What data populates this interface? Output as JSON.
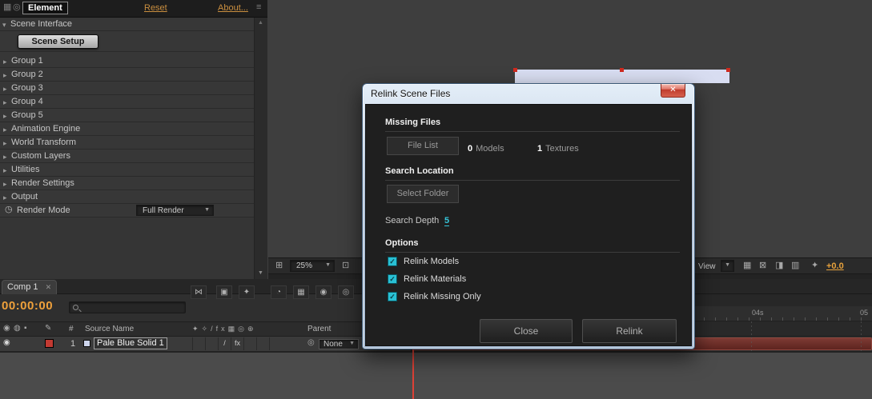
{
  "effect_panel": {
    "effect_name": "Element",
    "reset_label": "Reset",
    "about_label": "About...",
    "scene_interface_label": "Scene Interface",
    "scene_setup_button": "Scene Setup",
    "groups": [
      "Group 1",
      "Group 2",
      "Group 3",
      "Group 4",
      "Group 5",
      "Animation Engine",
      "World Transform",
      "Custom Layers",
      "Utilities",
      "Render Settings",
      "Output"
    ],
    "render_mode_label": "Render Mode",
    "render_mode_value": "Full Render"
  },
  "viewport": {
    "zoom_value": "25%",
    "view_label": "View",
    "exposure_value": "+0.0"
  },
  "dialog": {
    "title": "Relink Scene Files",
    "missing_files_heading": "Missing Files",
    "file_list_button": "File List",
    "models_count": "0",
    "models_label": "Models",
    "textures_count": "1",
    "textures_label": "Textures",
    "search_location_heading": "Search Location",
    "select_folder_button": "Select Folder",
    "search_depth_label": "Search Depth",
    "search_depth_value": "5",
    "options_heading": "Options",
    "checkboxes": [
      {
        "label": "Relink Models",
        "checked": true
      },
      {
        "label": "Relink Materials",
        "checked": true
      },
      {
        "label": "Relink Missing Only",
        "checked": true
      }
    ],
    "close_button": "Close",
    "relink_button": "Relink",
    "accent_color": "#29c0d4"
  },
  "timeline": {
    "tab_label": "Comp 1",
    "timecode": "00:00:00",
    "search_value": "",
    "columns": {
      "number": "#",
      "source": "Source Name",
      "parent": "Parent"
    },
    "switch_header_glyphs": "✦✧/fx▦◎⊕",
    "layer": {
      "index": "1",
      "name": "Pale Blue Solid 1",
      "quality_glyph": "/",
      "fx_glyph": "fx",
      "parent_value": "None"
    },
    "ruler_labels": [
      "04s",
      "05"
    ]
  },
  "icons": {
    "panel_grid_icon": "▦",
    "effect_badge_icon": "◎",
    "panel_menu_icon": "≡",
    "expand_open_icon": "▾",
    "expand_closed_icon": "▸",
    "stopwatch_icon": "◷",
    "dropdown_arrow_icon": "▼",
    "scroll_up_icon": "▲",
    "scroll_down_icon": "▼",
    "grid_options_icon": "⊞",
    "roi_icon": "⊡",
    "snapshot_icon": "⊠",
    "channels_icon": "◨",
    "resolution_icon": "▥",
    "fast_preview_icon": "✦",
    "mini_flowchart_icon": "⋈",
    "live_update_icon": "▣",
    "draft_3d_icon": "✦",
    "hide_shy_icon": "◔",
    "frame_blend_icon": "▦",
    "motion_blur_icon": "◉",
    "graph_editor_icon": "◎",
    "eye_icon": "◉",
    "audio_icon": "◍",
    "lock_icon": "▪",
    "pencil_icon": "✎",
    "pickwhip_icon": "◎",
    "close_x_icon": "✕",
    "tab_close_icon": "✕",
    "check_icon": "✓"
  }
}
